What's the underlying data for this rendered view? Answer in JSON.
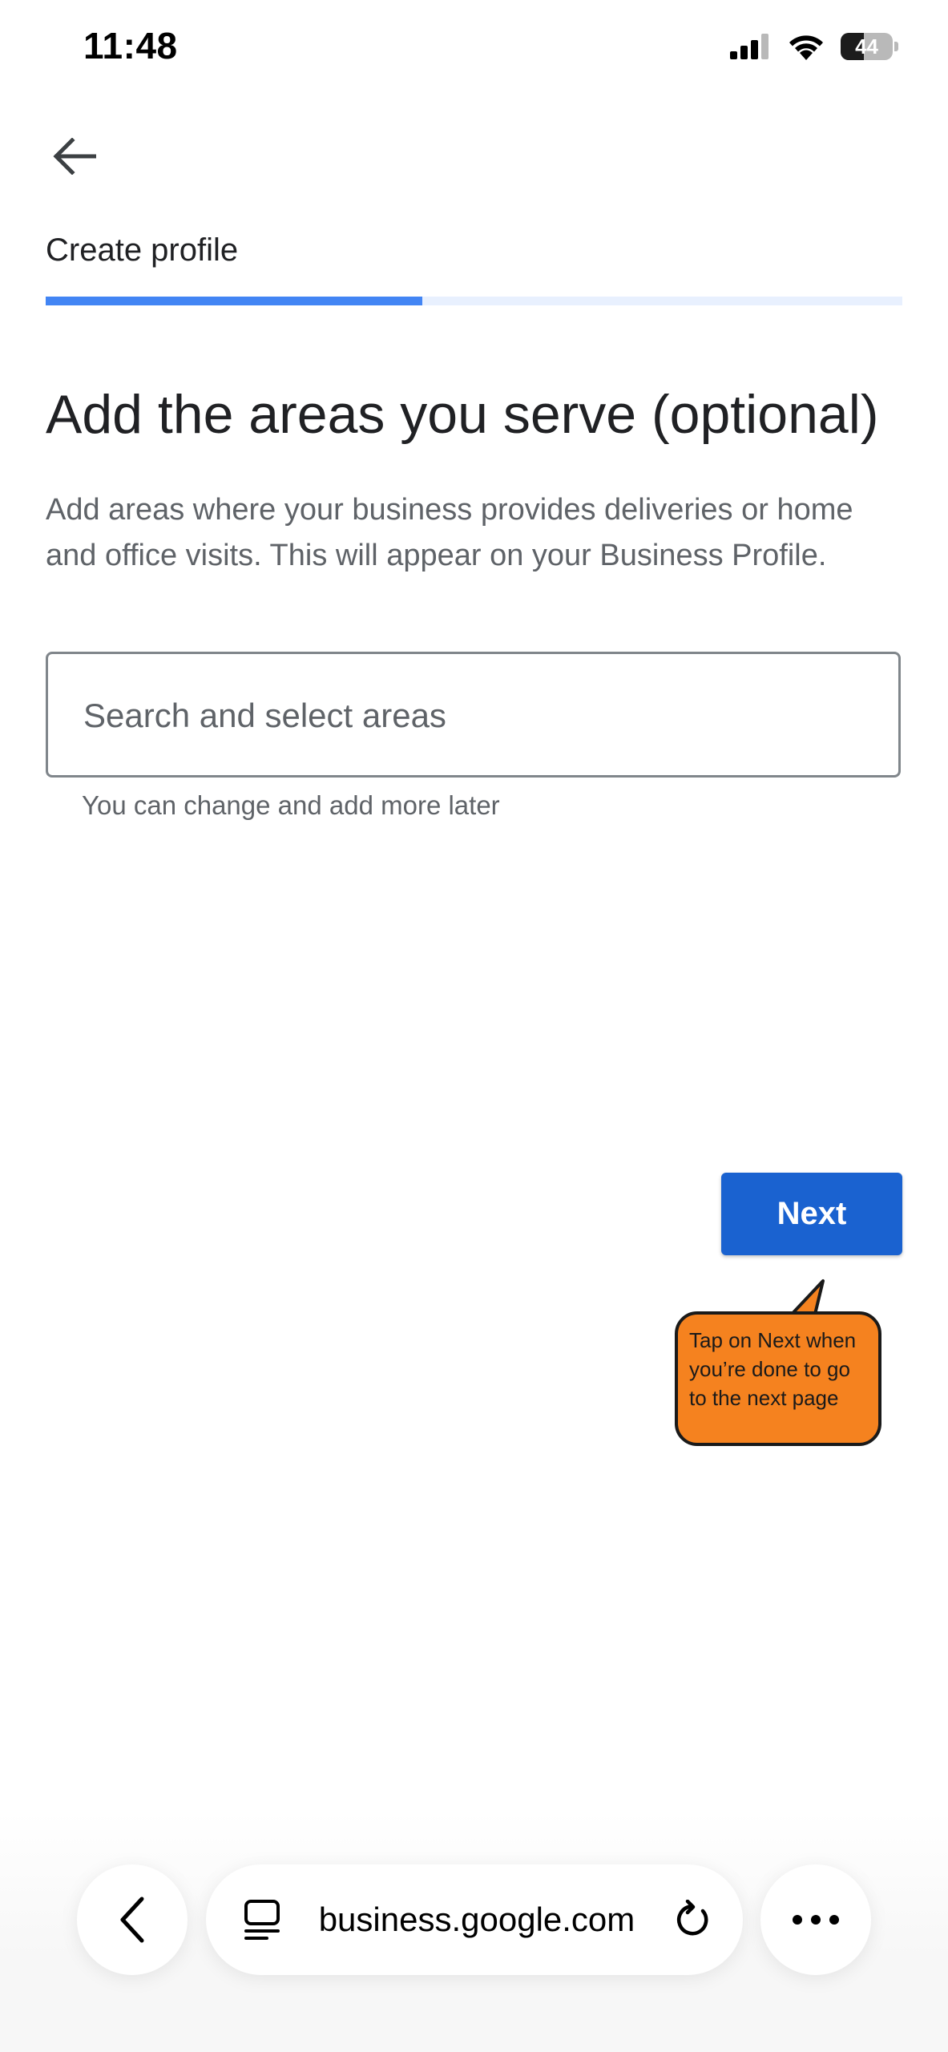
{
  "status_bar": {
    "time": "11:48",
    "battery_level": "44",
    "battery_fraction": 0.44,
    "icons": [
      "signal-icon",
      "wifi-icon",
      "battery-icon"
    ]
  },
  "header": {
    "back_icon": "arrow-left-icon",
    "title": "Create profile",
    "progress_fraction": 0.44,
    "progress_color": "#4285f4",
    "track_color": "#e8f0fe"
  },
  "main": {
    "heading": "Add the areas you serve (optional)",
    "description": "Add areas where your business provides deliveries or home and office visits. This will appear on your Business Profile.",
    "search": {
      "placeholder": "Search and select areas",
      "value": ""
    },
    "helper_text": "You can change and add more later"
  },
  "next_button": {
    "label": "Next",
    "color": "#1a62d0"
  },
  "tooltip": {
    "text": "Tap on Next when you’re done to go to the next page",
    "color": "#f5821f"
  },
  "browser_bar": {
    "back_icon": "chevron-left-icon",
    "tabs_icon": "tab-overview-icon",
    "url": "business.google.com",
    "reload_icon": "reload-icon",
    "more_icon": "more-horizontal-icon"
  }
}
